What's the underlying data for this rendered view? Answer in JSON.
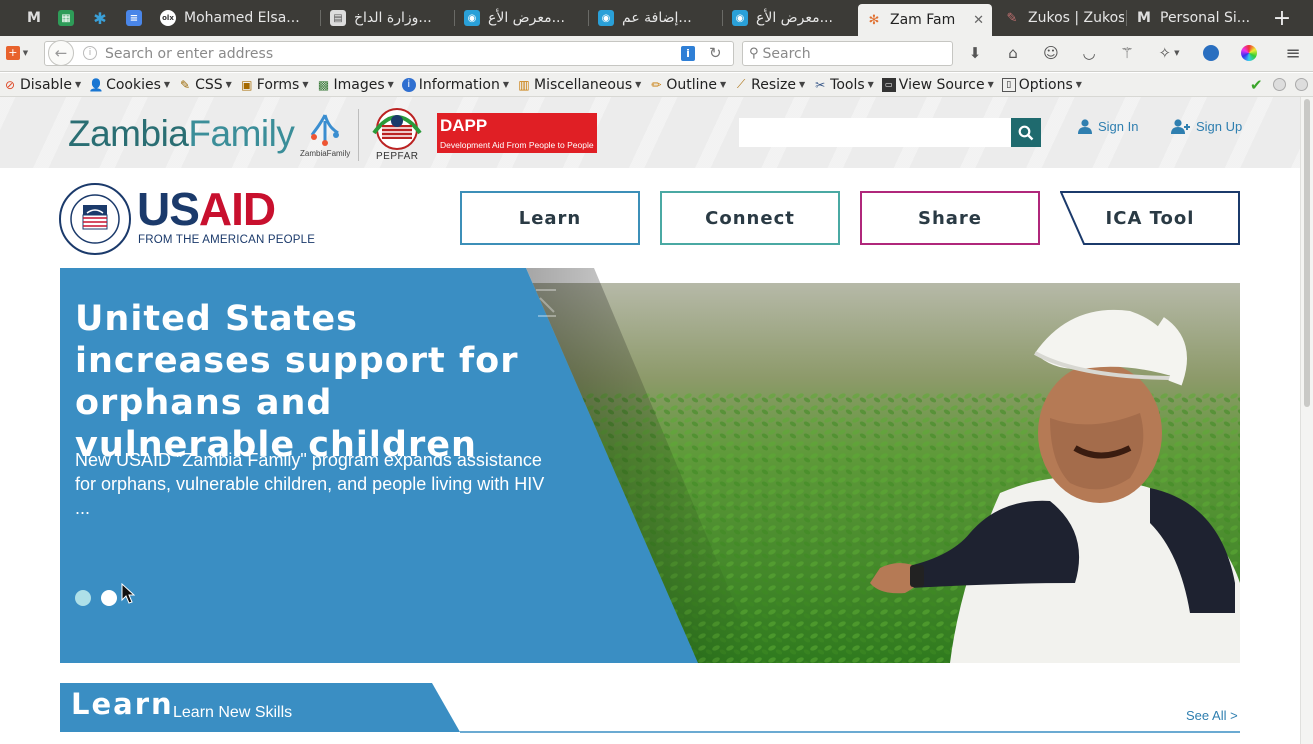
{
  "browser": {
    "tabs": [
      {
        "title": "",
        "icon": "gmail-icon",
        "color": "#4a4a4a"
      },
      {
        "title": "",
        "icon": "sheets-icon",
        "color": "#2e9c58"
      },
      {
        "title": "",
        "icon": "asterisk-icon",
        "color": "#3aa0d8"
      },
      {
        "title": "",
        "icon": "docs-icon",
        "color": "#4a86e8"
      },
      {
        "title": "Mohamed Elsa...",
        "icon": "olx-icon",
        "color": "#ffffff"
      },
      {
        "title": "وزارة الداخ...",
        "icon": "document-icon",
        "color": "#cccccc"
      },
      {
        "title": "معرض الأع...",
        "icon": "circle-app-icon",
        "color": "#2aa0d8"
      },
      {
        "title": "إضافة عم...",
        "icon": "circle-app-icon",
        "color": "#2aa0d8"
      },
      {
        "title": "معرض الأع...",
        "icon": "circle-app-icon",
        "color": "#2aa0d8"
      },
      {
        "title": "Zam Fam",
        "icon": "zambia-family-icon",
        "color": "#e07030",
        "active": true
      },
      {
        "title": "Zukos | Zukos",
        "icon": "zukos-icon",
        "color": "#b06060"
      },
      {
        "title": "Personal Si...",
        "icon": "gmail-icon",
        "color": "#4a4a4a"
      }
    ],
    "address_placeholder": "Search or enter address",
    "search_placeholder": "Search",
    "devtoolbar": [
      {
        "label": "Disable",
        "icon": "disable-icon"
      },
      {
        "label": "Cookies",
        "icon": "cookies-icon"
      },
      {
        "label": "CSS",
        "icon": "css-icon"
      },
      {
        "label": "Forms",
        "icon": "forms-icon"
      },
      {
        "label": "Images",
        "icon": "images-icon"
      },
      {
        "label": "Information",
        "icon": "information-icon"
      },
      {
        "label": "Miscellaneous",
        "icon": "miscellaneous-icon"
      },
      {
        "label": "Outline",
        "icon": "outline-icon"
      },
      {
        "label": "Resize",
        "icon": "resize-icon"
      },
      {
        "label": "Tools",
        "icon": "tools-icon"
      },
      {
        "label": "View Source",
        "icon": "view-source-icon"
      },
      {
        "label": "Options",
        "icon": "options-icon"
      }
    ]
  },
  "site": {
    "logo_part1": "Zambia",
    "logo_part2": "Family",
    "logo_small": "ZambiaFamily",
    "pepfar": "PEPFAR",
    "dapp_title": "DAPP",
    "dapp_subtitle": "Development Aid From People to People",
    "search_value": "",
    "sign_in": "Sign In",
    "sign_up": "Sign Up",
    "usaid_us": "US",
    "usaid_aid": "AID",
    "usaid_tagline": "FROM THE AMERICAN PEOPLE",
    "nav": {
      "learn": "Learn",
      "connect": "Connect",
      "share": "Share",
      "ica": "ICA Tool"
    },
    "hero": {
      "title": "United States increases support for orphans and vulnerable children",
      "text": "New USAID \"Zambia Family\" program expands assistance for orphans, vulnerable children, and people living with HIV ...",
      "slides": 2,
      "active_slide": 1
    },
    "section": {
      "title": "Learn",
      "subtitle": "Learn New Skills",
      "see_all": "See All >"
    }
  },
  "colors": {
    "hero_blue": "#3a8ec3",
    "teal": "#1f6a6e",
    "usaid_blue": "#1b3a6b",
    "usaid_red": "#c8102e",
    "share_magenta": "#b0277b"
  }
}
